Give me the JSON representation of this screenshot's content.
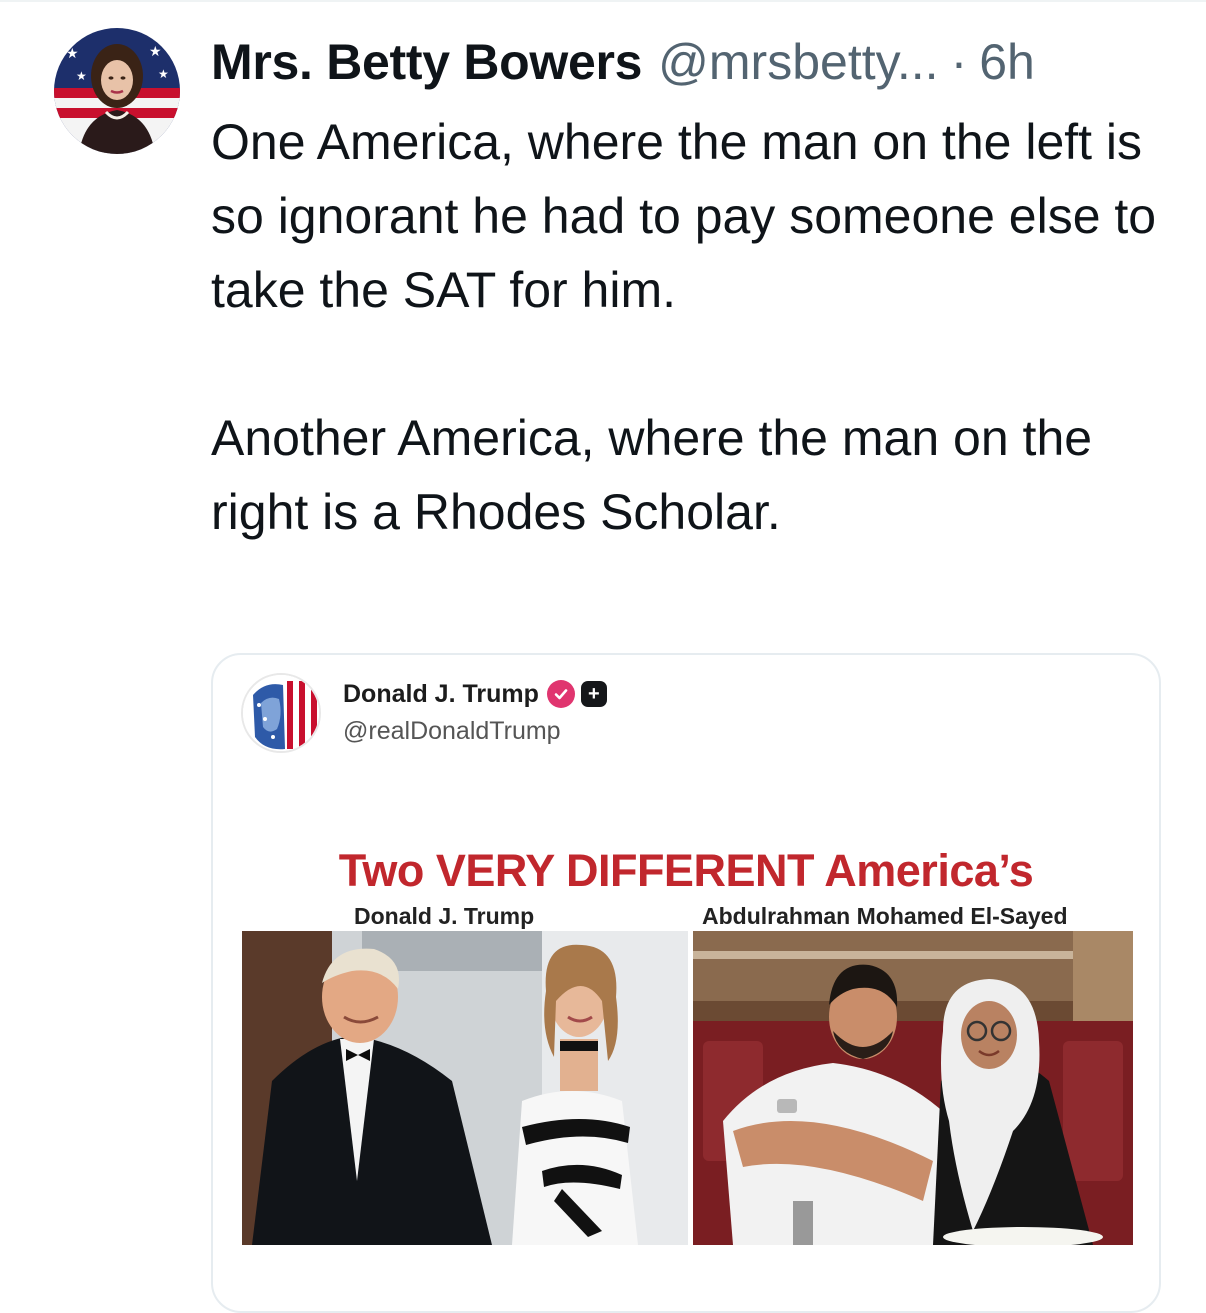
{
  "tweet": {
    "author_name": "Mrs. Betty Bowers",
    "author_handle": "@mrsbetty...",
    "separator": "·",
    "time": "6h",
    "text_paragraph_1": "One America, where the man on the left is so ignorant he had to pay someone else to take the SAT for him.",
    "text_paragraph_2": "Another America, where the man on the right is a Rhodes Scholar."
  },
  "quoted": {
    "author_name": "Donald J. Trump",
    "author_handle": "@realDonaldTrump",
    "plus_badge": "+",
    "image": {
      "headline": "Two VERY DIFFERENT America’s",
      "left_caption": "Donald J. Trump",
      "right_caption": "Abdulrahman Mohamed El-Sayed"
    }
  },
  "colors": {
    "text_primary": "#0f1419",
    "text_secondary": "#536471",
    "headline_red": "#c1272d",
    "verified_pink": "#e0356f",
    "card_border": "#e6ecf0"
  },
  "icons": {
    "verified": "verified-check-icon",
    "plus": "plus-badge-icon"
  }
}
